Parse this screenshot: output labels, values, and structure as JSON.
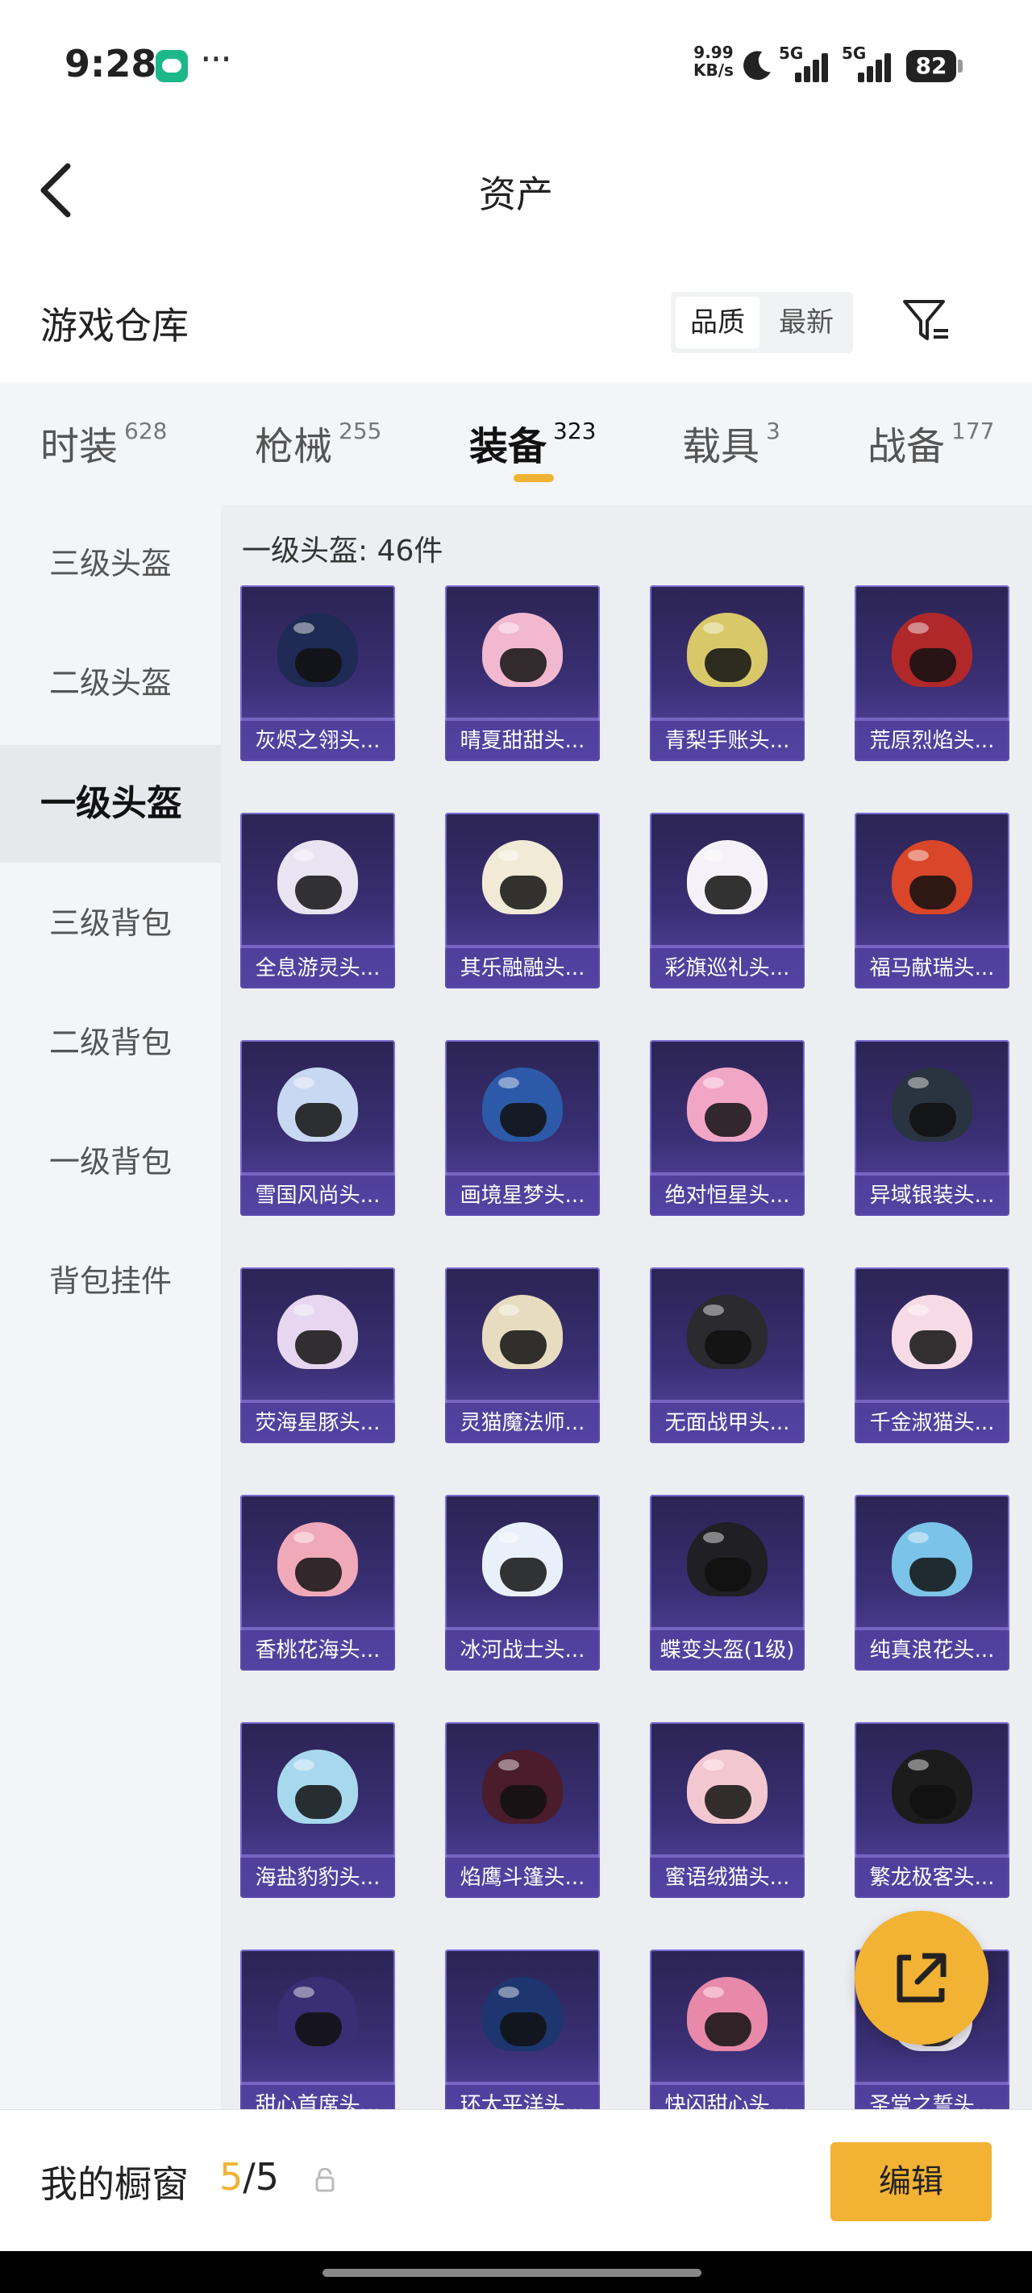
{
  "status": {
    "time": "9:28",
    "speed_value": "9.99",
    "speed_unit": "KB/s",
    "signal1": "5G",
    "signal2": "5G",
    "battery": "82"
  },
  "header": {
    "title": "资产",
    "section": "游戏仓库",
    "sort_options": [
      "品质",
      "最新"
    ]
  },
  "tabs": [
    {
      "label": "时装",
      "count": "628"
    },
    {
      "label": "枪械",
      "count": "255"
    },
    {
      "label": "装备",
      "count": "323"
    },
    {
      "label": "载具",
      "count": "3"
    },
    {
      "label": "战备",
      "count": "177"
    }
  ],
  "sidebar": {
    "items": [
      "三级头盔",
      "二级头盔",
      "一级头盔",
      "三级背包",
      "二级背包",
      "一级背包",
      "背包挂件"
    ],
    "active": "一级头盔"
  },
  "grid": {
    "label": "一级头盔: 46件",
    "items": [
      {
        "name": "灰烬之翎头...",
        "color": "#1f2a55"
      },
      {
        "name": "晴夏甜甜头...",
        "color": "#f2b8cf"
      },
      {
        "name": "青梨手账头...",
        "color": "#d8c86a"
      },
      {
        "name": "荒原烈焰头...",
        "color": "#b0282a"
      },
      {
        "name": "全息游灵头...",
        "color": "#e8e4f2"
      },
      {
        "name": "其乐融融头...",
        "color": "#f1ead6"
      },
      {
        "name": "彩旗巡礼头...",
        "color": "#f4f2f8"
      },
      {
        "name": "福马献瑞头...",
        "color": "#d9462a"
      },
      {
        "name": "雪国风尚头...",
        "color": "#c9d8f2"
      },
      {
        "name": "画境星梦头...",
        "color": "#2c5aa8"
      },
      {
        "name": "绝对恒星头...",
        "color": "#f2a6c6"
      },
      {
        "name": "异域银装头...",
        "color": "#2a3340"
      },
      {
        "name": "荧海星豚头...",
        "color": "#e6d6f0"
      },
      {
        "name": "灵猫魔法师...",
        "color": "#e8dcc0"
      },
      {
        "name": "无面战甲头...",
        "color": "#2b2b2f"
      },
      {
        "name": "千金淑猫头...",
        "color": "#f6dbe6"
      },
      {
        "name": "香桃花海头...",
        "color": "#f0a9b8"
      },
      {
        "name": "冰河战士头...",
        "color": "#e9f0fa"
      },
      {
        "name": "蝶变头盔(1级)",
        "color": "#1f1f24"
      },
      {
        "name": "纯真浪花头...",
        "color": "#7cc3ea"
      },
      {
        "name": "海盐豹豹头...",
        "color": "#a8d8ee"
      },
      {
        "name": "焰鹰斗篷头...",
        "color": "#4a1c2c"
      },
      {
        "name": "蜜语绒猫头...",
        "color": "#f3c7cf"
      },
      {
        "name": "繁龙极客头...",
        "color": "#1c1c1c"
      },
      {
        "name": "甜心首席头...",
        "color": "#3a2f74"
      },
      {
        "name": "环太平洋头...",
        "color": "#1d3670"
      },
      {
        "name": "快闪甜心头...",
        "color": "#e889aa"
      },
      {
        "name": "圣堂之誓头...",
        "color": "#e9e6ef"
      }
    ]
  },
  "bottom": {
    "label": "我的橱窗",
    "current": "5",
    "total": "/5",
    "edit": "编辑"
  },
  "colors": {
    "accent": "#f2b233",
    "card_bg": "#3a2f74"
  }
}
